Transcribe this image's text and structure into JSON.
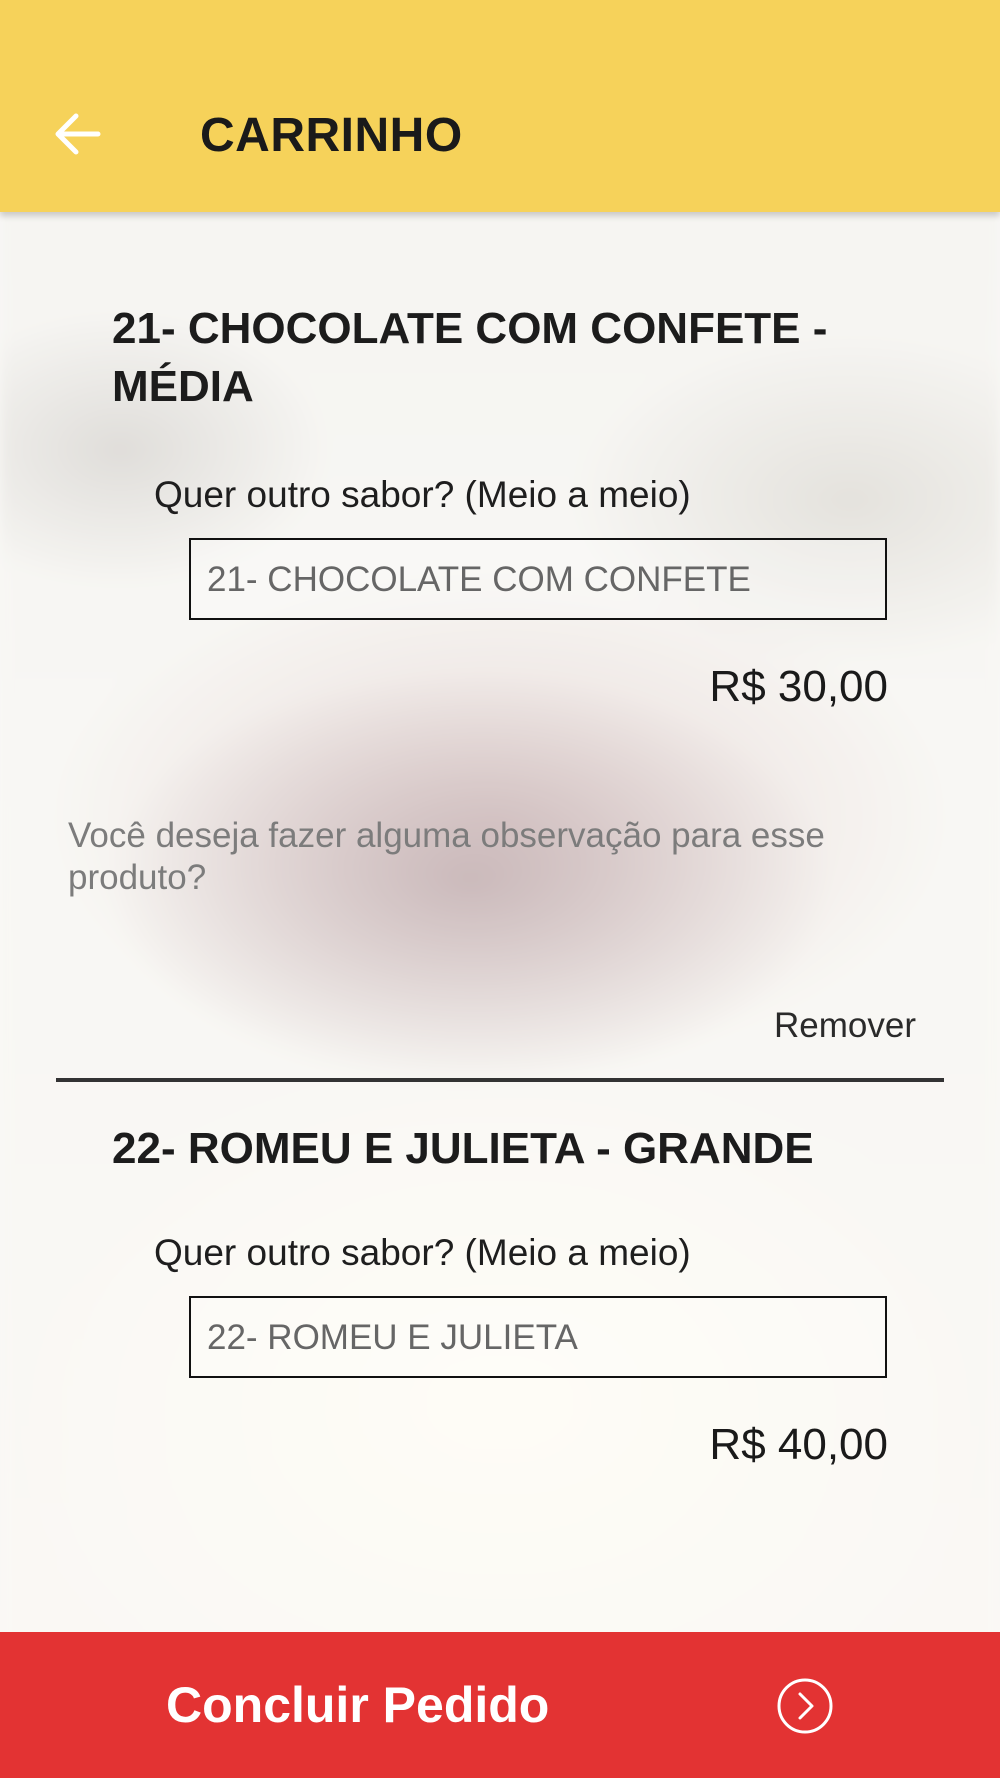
{
  "header": {
    "title": "CARRINHO",
    "back_icon": "arrow-left-icon",
    "bg_color": "#f6d25a"
  },
  "cart": {
    "items": [
      {
        "title": "21- CHOCOLATE COM CONFETE - MÉDIA",
        "half_label": "Quer outro sabor? (Meio a meio)",
        "flavor_value": "21- CHOCOLATE COM CONFETE",
        "price": "R$ 30,00",
        "note_placeholder": "Você deseja fazer alguma observação para esse produto?",
        "remove_label": "Remover"
      },
      {
        "title": "22- ROMEU E JULIETA - GRANDE",
        "half_label": "Quer outro sabor? (Meio a meio)",
        "flavor_value": "22- ROMEU E JULIETA",
        "price": "R$ 40,00"
      }
    ]
  },
  "footer": {
    "label": "Concluir Pedido",
    "icon": "chevron-circle-right-icon",
    "bg_color": "#e33333"
  }
}
